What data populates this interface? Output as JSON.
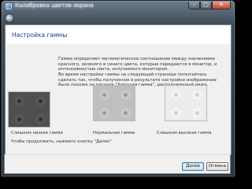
{
  "window": {
    "title": "Калибровка цветов экрана",
    "caption_buttons": {
      "minimize": "–",
      "maximize": "□",
      "close": "✕"
    },
    "back_icon": "back-arrow-icon"
  },
  "page": {
    "title": "Настройка гаммы",
    "description": [
      "Гамма определяет математическое соотношение между значениями красного, зеленого и синего цвета, которые передаются в монитор, и интенсивностью света, излучаемого монитором.",
      "Во время настройки гаммы на следующей странице попытайтесь сделать так, чтобы полученное в результате настройки изображение было похоже на рисунок \"Хорошая гамма\", расположенный ниже."
    ],
    "samples": [
      {
        "id": "low",
        "label": "Слишком низкая гамма",
        "shade": "#4f4f4f"
      },
      {
        "id": "normal",
        "label": "Нормальная гамма",
        "shade": "#bfbfbf"
      },
      {
        "id": "high",
        "label": "Слишком высокая гамма",
        "shade": "#ececec"
      }
    ],
    "hint": "Чтобы продолжить, нажмите кнопку \"Далее\"."
  },
  "footer": {
    "next_label": "Далее",
    "cancel_label": "Отмена"
  },
  "colors": {
    "title_blue": "#1e3f8f",
    "content_bg": "#f0f0f0",
    "frame_dark": "#2c343c"
  }
}
